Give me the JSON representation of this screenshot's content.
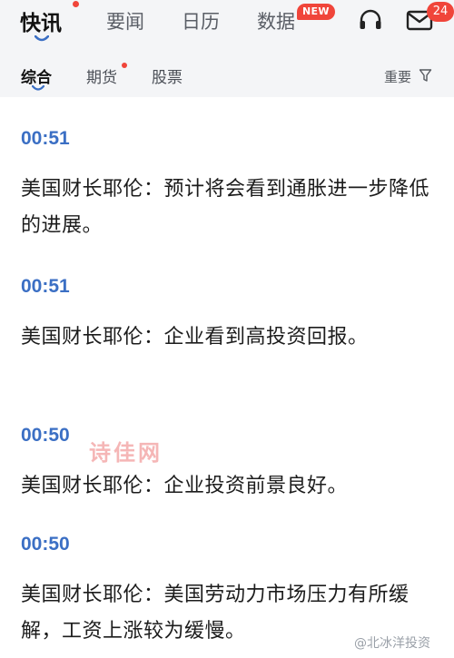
{
  "top_tabs": [
    {
      "label": "快讯"
    },
    {
      "label": "要闻"
    },
    {
      "label": "日历"
    },
    {
      "label": "数据"
    }
  ],
  "new_badge": "NEW",
  "message_count": "24",
  "sub_tabs": [
    {
      "label": "综合"
    },
    {
      "label": "期货"
    },
    {
      "label": "股票"
    }
  ],
  "sort_label": "重要",
  "icons": {
    "headset": "headset-icon",
    "mail": "mail-icon",
    "filter": "filter-icon"
  },
  "colors": {
    "accent": "#3b6fc4",
    "badge": "#f0453a"
  },
  "feed": [
    {
      "time": "00:51",
      "text": "美国财长耶伦：预计将会看到通胀进一步降低的进展。"
    },
    {
      "time": "00:51",
      "text": "美国财长耶伦：企业看到高投资回报。"
    },
    {
      "time": "00:50",
      "text": "美国财长耶伦：企业投资前景良好。"
    },
    {
      "time": "00:50",
      "text": "美国财长耶伦：美国劳动力市场压力有所缓解，工资上涨较为缓慢。"
    }
  ],
  "watermark": "诗佳网",
  "brand": "@北冰洋投资"
}
